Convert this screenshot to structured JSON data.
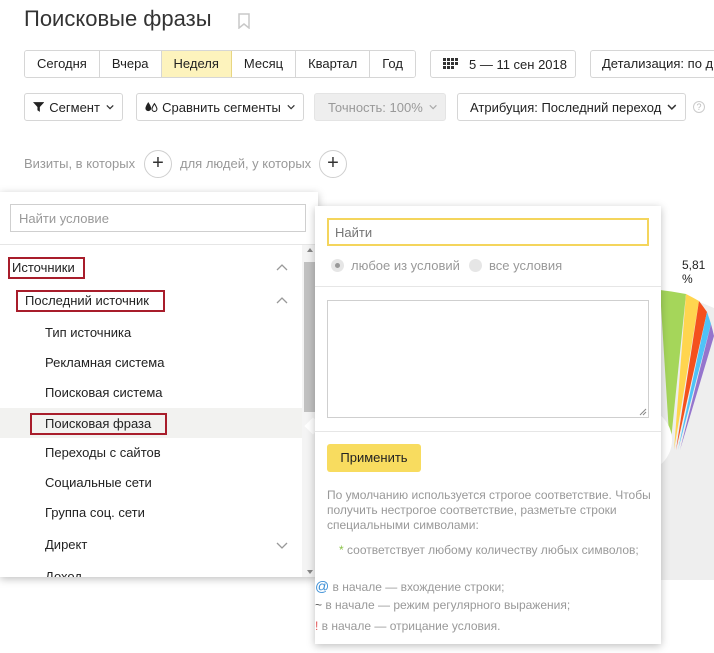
{
  "header": {
    "title": "Поисковые фразы"
  },
  "periods": [
    {
      "label": "Сегодня",
      "active": false
    },
    {
      "label": "Вчера",
      "active": false
    },
    {
      "label": "Неделя",
      "active": true
    },
    {
      "label": "Месяц",
      "active": false
    },
    {
      "label": "Квартал",
      "active": false
    },
    {
      "label": "Год",
      "active": false
    }
  ],
  "date_range": "5 — 11 сен 2018",
  "detail": "Детализация: по д",
  "toolbar": {
    "segment": "Сегмент",
    "compare": "Сравнить сегменты",
    "accuracy": "Точность: 100%",
    "attribution": "Атрибуция: Последний переход"
  },
  "segment_builder": {
    "visits_label": "Визиты, в которых",
    "people_label": "для людей, у которых"
  },
  "chart_label": "5,81 %",
  "condition_panel": {
    "search_placeholder": "Найти условие",
    "items": [
      {
        "label": "Источники"
      },
      {
        "label": "Последний источник"
      },
      {
        "label": "Тип источника"
      },
      {
        "label": "Рекламная система"
      },
      {
        "label": "Поисковая система"
      },
      {
        "label": "Поисковая фраза"
      },
      {
        "label": "Переходы с сайтов"
      },
      {
        "label": "Социальные сети"
      },
      {
        "label": "Группа соц. сети"
      },
      {
        "label": "Директ"
      },
      {
        "label": "Доход"
      }
    ]
  },
  "filter_panel": {
    "find_placeholder": "Найти",
    "radio_any": "любое из условий",
    "radio_all": "все условия",
    "apply": "Применить",
    "help": "По умолчанию используется строгое соответствие. Чтобы получить нестрогое соответствие, разметьте строки специальными символами:",
    "hints": [
      {
        "symbol": "*",
        "text": " соответствует любому количеству любых символов;"
      },
      {
        "symbol": "@",
        "text": " в начале — вхождение строки;"
      },
      {
        "symbol": "~",
        "text": " в начале — режим регулярного выражения;"
      },
      {
        "symbol": "!",
        "text": " в начале — отрицание условия."
      }
    ]
  },
  "colors": {
    "accent_yellow": "#f8dc5f",
    "highlight_border": "#a81d2b",
    "active_tab": "#fdf3bd"
  }
}
